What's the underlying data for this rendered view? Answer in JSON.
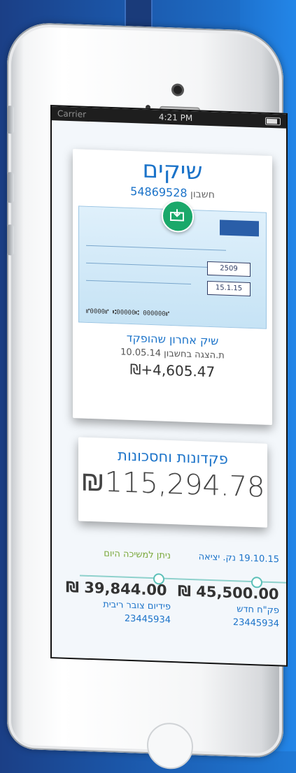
{
  "status_bar": {
    "carrier": "Carrier",
    "time": "4:21 PM"
  },
  "checks": {
    "title": "שיקים",
    "account_label": "חשבון",
    "account_number": "54869528",
    "last_deposited_label": "שיק אחרון שהופקד",
    "date_label": "ת.הצגה בחשבון 10.05.14",
    "amount": "₪+4,605.47",
    "cheque_amount": "2509",
    "cheque_date": "15.1.15"
  },
  "savings": {
    "title": "פקדונות וחסכונות",
    "amount": "₪115,294.78"
  },
  "deposits": [
    {
      "header": "19.10.15 נק. יציאה",
      "amount": "₪ 45,500.00",
      "name": "פק\"ח חדש",
      "number": "23445934"
    },
    {
      "header": "ניתן למשיכה היום",
      "amount": "₪ 39,844.00",
      "name": "פידיום צובר ריבית",
      "number": "23445934"
    }
  ],
  "colors": {
    "accent": "#1b73c9",
    "timeline": "#5bc0b8",
    "deposit_green": "#1aa86a"
  }
}
